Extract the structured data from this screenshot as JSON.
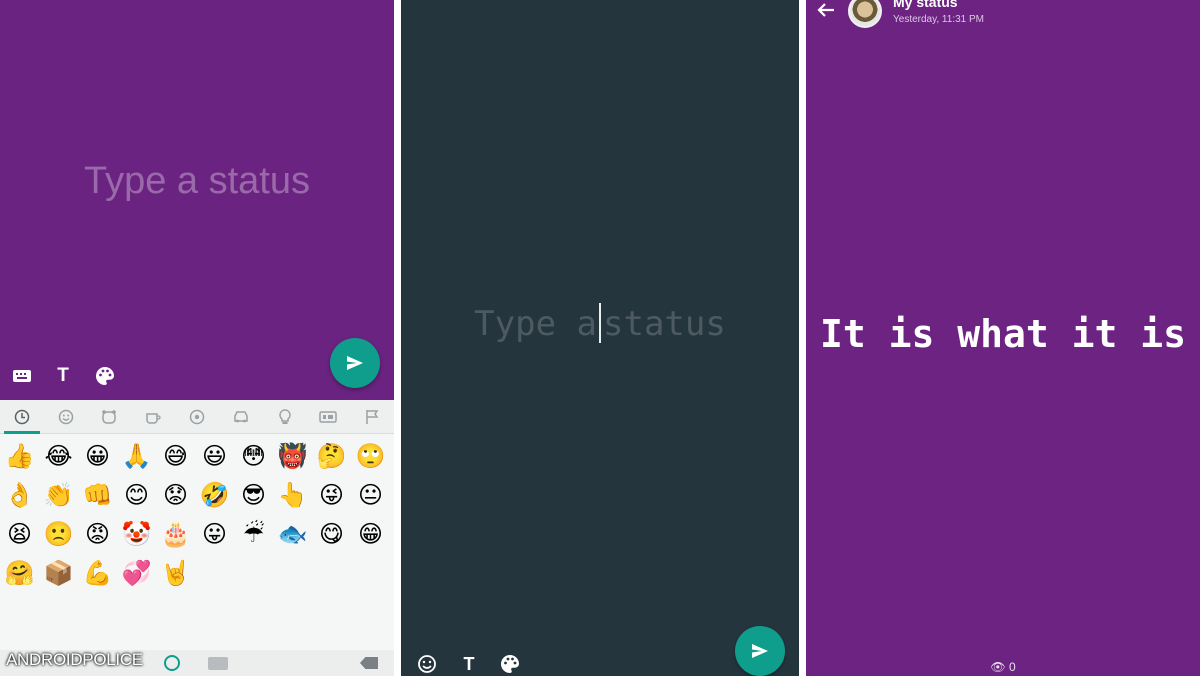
{
  "panel1": {
    "placeholder": "Type a status",
    "background_color": "#6a2381",
    "toolbar": [
      "keyboard-icon",
      "text-icon",
      "palette-icon"
    ],
    "send_color": "#0f9d8c",
    "keyboard": {
      "tabs": [
        "recent-icon",
        "smiley-icon",
        "animal-icon",
        "food-icon",
        "activity-icon",
        "travel-icon",
        "objects-icon",
        "symbols-icon",
        "flags-icon"
      ],
      "emoji_rows": [
        [
          "👍",
          "😂",
          "😀",
          "🙏",
          "😅",
          "😃",
          "😳",
          "👹",
          "🤔",
          "🙄"
        ],
        [
          "👌",
          "👏",
          "👊",
          "😊",
          "😟",
          "🤣",
          "😎",
          "👆",
          "😜",
          "😐"
        ],
        [
          "😫",
          "🙁",
          "😡",
          "🤡",
          "🎂",
          "😛",
          "☔",
          "🐟",
          "😋",
          "😁"
        ],
        [
          "🤗",
          "📦",
          "💪",
          "💞",
          "🤘"
        ]
      ]
    },
    "watermark": "ANDROIDPOLICE"
  },
  "panel2": {
    "placeholder_before": "Type a",
    "placeholder_after": "status",
    "background_color": "#25353e",
    "toolbar": [
      "emoji-icon",
      "text-icon",
      "palette-icon"
    ]
  },
  "panel3": {
    "name": "My status",
    "time": "Yesterday, 11:31 PM",
    "status_text": "It is what it is",
    "view_count": "0",
    "background_color": "#6d2382"
  }
}
